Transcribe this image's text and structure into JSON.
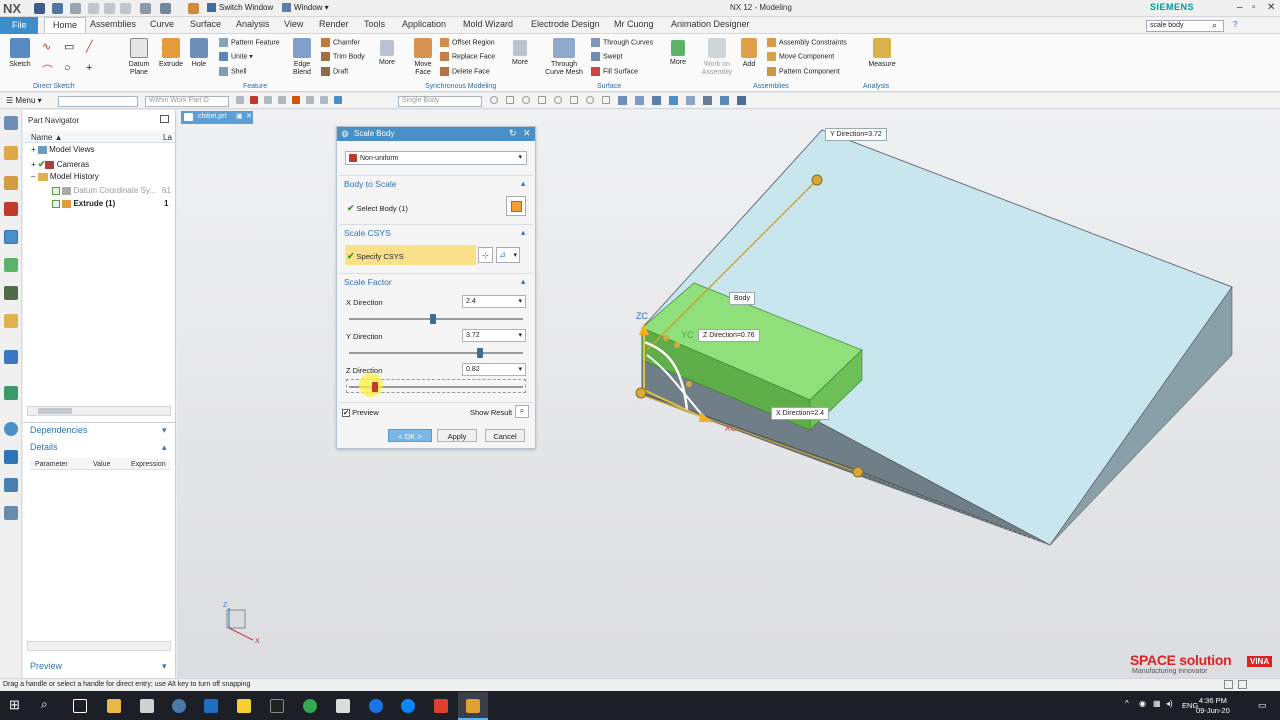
{
  "window": {
    "app_logo": "NX",
    "title": "NX 12 - Modeling",
    "brand": "SIEMENS",
    "quick_access": {
      "switch_window": "Switch Window",
      "window_menu": "Window"
    }
  },
  "menu_tabs": [
    "File",
    "Home",
    "Assemblies",
    "Curve",
    "Surface",
    "Analysis",
    "View",
    "Render",
    "Tools",
    "Application",
    "Mold Wizard",
    "Electrode Design",
    "Mr Cuong",
    "Animation Designer"
  ],
  "search": {
    "value": "scale body"
  },
  "ribbon": {
    "direct_sketch": {
      "sketch": "Sketch",
      "group": "Direct Sketch"
    },
    "feature": {
      "datum_plane": "Datum Plane",
      "extrude": "Extrude",
      "hole": "Hole",
      "pattern_feature": "Pattern Feature",
      "unite": "Unite",
      "shell": "Shell",
      "edge_blend": "Edge Blend",
      "chamfer": "Chamfer",
      "trim_body": "Trim Body",
      "draft": "Draft",
      "more": "More",
      "group": "Feature"
    },
    "sync": {
      "move_face": "Move Face",
      "offset_region": "Offset Region",
      "replace_face": "Replace Face",
      "delete_face": "Delete Face",
      "more": "More",
      "group": "Synchronous Modeling"
    },
    "surface": {
      "through_curve_mesh": "Through Curve Mesh",
      "through_curves": "Through Curves",
      "swept": "Swept",
      "fill_surface": "Fill Surface",
      "more": "More",
      "group": "Surface"
    },
    "assemblies": {
      "work_on_assembly": "Work on Assembly",
      "add": "Add",
      "assembly_constraints": "Assembly Constraints",
      "move_component": "Move Component",
      "pattern_component": "Pattern Component",
      "group": "Assemblies"
    },
    "analysis": {
      "measure": "Measure",
      "group": "Analysis"
    }
  },
  "toolbar2": {
    "menu": "Menu",
    "filter_scope": "Within Work Part O",
    "selection_type": "Single Body"
  },
  "part_navigator": {
    "title": "Part Navigator",
    "col_name": "Name",
    "col_la": "La",
    "items": [
      {
        "label": "Model Views",
        "value": ""
      },
      {
        "label": "Cameras",
        "value": ""
      },
      {
        "label": "Model History",
        "value": ""
      },
      {
        "label": "Datum Coordinate Sy...",
        "value": "61"
      },
      {
        "label": "Extrude (1)",
        "value": "1"
      }
    ],
    "dependencies": "Dependencies",
    "details": "Details",
    "details_cols": [
      "Parameter",
      "Value",
      "Expression"
    ],
    "preview": "Preview"
  },
  "file_tab": {
    "name": "chitiet.prt"
  },
  "dialog": {
    "title": "Scale Body",
    "type_value": "Non-uniform",
    "body_to_scale": "Body to Scale",
    "select_body": "Select Body (1)",
    "scale_csys": "Scale CSYS",
    "specify_csys": "Specify CSYS",
    "scale_factor": "Scale Factor",
    "x_label": "X Direction",
    "x_value": "2.4",
    "x_slider": 0.48,
    "y_label": "Y Direction",
    "y_value": "3.72",
    "y_slider": 0.75,
    "z_label": "Z Direction",
    "z_value": "0.82",
    "z_slider": 0.15,
    "preview": "Preview",
    "show_result": "Show Result",
    "ok": "< OK >",
    "apply": "Apply",
    "cancel": "Cancel"
  },
  "viewport": {
    "y_direction": "Y Direction=3.72",
    "body": "Body",
    "z_direction": "Z Direction=0.76",
    "x_direction": "X Direction=2.4",
    "axis_zc": "ZC",
    "axis_yc": "YC",
    "axis_xc": "XC",
    "triad_z": "Z",
    "triad_x": "X"
  },
  "watermark": {
    "brand": "SPACE solution",
    "sub": "Manufacturing Innovator",
    "vina": "VINA"
  },
  "status_bar": "Drag a handle or select a handle for direct entry; use Alt key to turn off snapping",
  "taskbar": {
    "lang": "ENG",
    "time": "4:36 PM",
    "date": "09-Jun-20"
  },
  "colors": {
    "accent": "#4a90c8",
    "highlight": "#fbe08a",
    "body_green": "#8fe07a",
    "slab": "#c7e3ec"
  }
}
